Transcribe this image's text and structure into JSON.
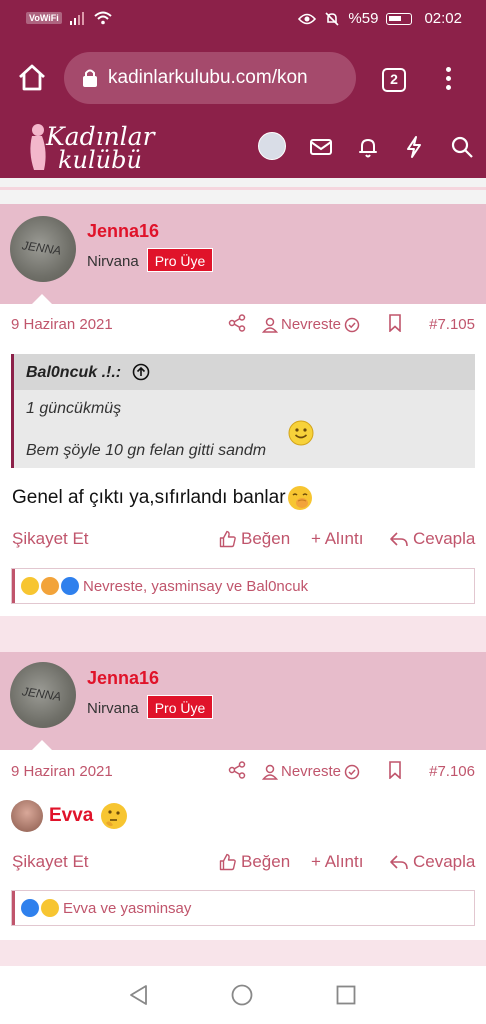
{
  "status": {
    "wifi_label": "VoWiFi",
    "battery": "%59",
    "time": "02:02"
  },
  "browser": {
    "url": "kadinlarkulubu.com/kon",
    "tab_count": "2"
  },
  "site": {
    "logo_line1": "Kadınlar",
    "logo_line2": "kulübü"
  },
  "posts": [
    {
      "username": "Jenna16",
      "avatar_text": "JENNA",
      "user_title": "Nirvana",
      "badge": "Pro Üye",
      "date": "9 Haziran 2021",
      "author_label": "Nevreste",
      "post_number": "#7.105",
      "quote": {
        "author": "Bal0ncuk .!.:",
        "line1": "1 güncükmüş",
        "line2": "Bem şöyle 10 gn felan gitti sandm"
      },
      "body": "Genel af çıktı ya,sıfırlandı banlar",
      "report": "Şikayet Et",
      "like": "Beğen",
      "quote_action": "+ Alıntı",
      "reply": "Cevapla",
      "reactions_text": "Nevreste, yasminsay ve Bal0ncuk"
    },
    {
      "username": "Jenna16",
      "avatar_text": "JENNA",
      "user_title": "Nirvana",
      "badge": "Pro Üye",
      "date": "9 Haziran 2021",
      "author_label": "Nevreste",
      "post_number": "#7.106",
      "mention": "Evva",
      "report": "Şikayet Et",
      "like": "Beğen",
      "quote_action": "+ Alıntı",
      "reply": "Cevapla",
      "reactions_text": "Evva ve yasminsay"
    }
  ],
  "colors": {
    "brand": "#8c2149",
    "accent": "#c0556c",
    "header_pink": "#e7bccb",
    "username_red": "#e0132a"
  }
}
